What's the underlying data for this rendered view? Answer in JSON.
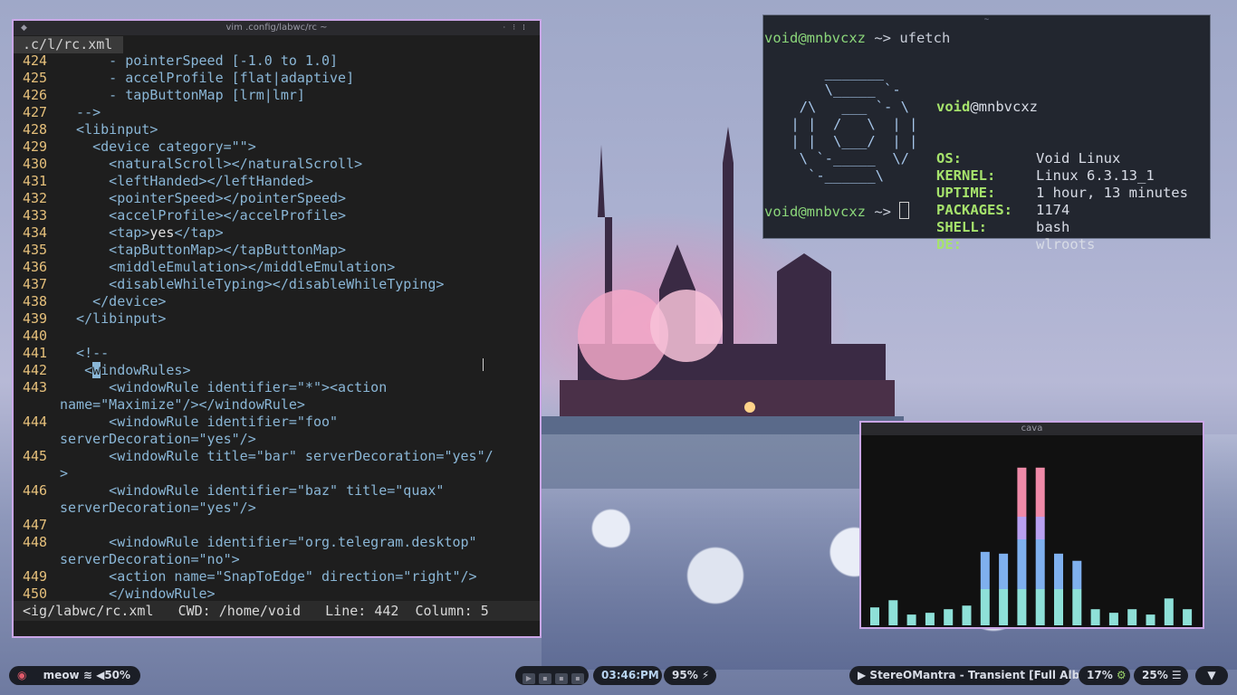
{
  "vim": {
    "title": "vim .config/labwc/rc ~",
    "tab": ".c/l/rc.xml",
    "lines": [
      {
        "n": "424",
        "t": "      - pointerSpeed [-1.0 to 1.0]"
      },
      {
        "n": "425",
        "t": "      - accelProfile [flat|adaptive]"
      },
      {
        "n": "426",
        "t": "      - tapButtonMap [lrm|lmr]"
      },
      {
        "n": "427",
        "t": "  -->"
      },
      {
        "n": "428",
        "t": "  <libinput>"
      },
      {
        "n": "429",
        "t": "    <device category=\"\">"
      },
      {
        "n": "430",
        "t": "      <naturalScroll></naturalScroll>"
      },
      {
        "n": "431",
        "t": "      <leftHanded></leftHanded>"
      },
      {
        "n": "432",
        "t": "      <pointerSpeed></pointerSpeed>"
      },
      {
        "n": "433",
        "t": "      <accelProfile></accelProfile>"
      },
      {
        "n": "434",
        "t": "      <tap>yes</tap>"
      },
      {
        "n": "435",
        "t": "      <tapButtonMap></tapButtonMap>"
      },
      {
        "n": "436",
        "t": "      <middleEmulation></middleEmulation>"
      },
      {
        "n": "437",
        "t": "      <disableWhileTyping></disableWhileTyping>"
      },
      {
        "n": "438",
        "t": "    </device>"
      },
      {
        "n": "439",
        "t": "  </libinput>"
      },
      {
        "n": "440",
        "t": ""
      },
      {
        "n": "441",
        "t": "  <!--"
      },
      {
        "n": "442",
        "t": "   <windowRules>"
      },
      {
        "n": "443",
        "t": "      <windowRule identifier=\"*\"><action"
      },
      {
        "n": "",
        "t": "name=\"Maximize\"/></windowRule>"
      },
      {
        "n": "444",
        "t": "      <windowRule identifier=\"foo\""
      },
      {
        "n": "",
        "t": "serverDecoration=\"yes\"/>"
      },
      {
        "n": "445",
        "t": "      <windowRule title=\"bar\" serverDecoration=\"yes\"/"
      },
      {
        "n": "",
        "t": ">"
      },
      {
        "n": "446",
        "t": "      <windowRule identifier=\"baz\" title=\"quax\""
      },
      {
        "n": "",
        "t": "serverDecoration=\"yes\"/>"
      },
      {
        "n": "447",
        "t": ""
      },
      {
        "n": "448",
        "t": "      <windowRule identifier=\"org.telegram.desktop\""
      },
      {
        "n": "",
        "t": "serverDecoration=\"no\">"
      },
      {
        "n": "449",
        "t": "      <action name=\"SnapToEdge\" direction=\"right\"/>"
      },
      {
        "n": "450",
        "t": "      </windowRule>"
      }
    ],
    "status": "<ig/labwc/rc.xml   CWD: /home/void   Line: 442  Column: 5"
  },
  "terminal": {
    "title": "~",
    "prompt_user": "void",
    "prompt_host": "@mnbvcxz",
    "prompt_arrow": " ~> ",
    "command": "ufetch",
    "logo": [
      "     _______",
      "     \\_____ `-",
      "  /\\   ___ `- \\",
      " | |  /   \\  | |",
      " | |  \\___/  | |",
      "  \\ `-_____  \\/",
      "   `-______\\"
    ],
    "info_title_user": "void",
    "info_title_host": "@mnbvcxz",
    "info": [
      {
        "k": "OS:",
        "v": "Void Linux"
      },
      {
        "k": "KERNEL:",
        "v": "Linux 6.3.13_1"
      },
      {
        "k": "UPTIME:",
        "v": "1 hour, 13 minutes"
      },
      {
        "k": "PACKAGES:",
        "v": "1174"
      },
      {
        "k": "SHELL:",
        "v": "bash"
      },
      {
        "k": "DE:",
        "v": "wlroots"
      }
    ]
  },
  "cava": {
    "title": "cava",
    "levels": [
      0.1,
      0.14,
      0.06,
      0.07,
      0.09,
      0.11,
      0.41,
      0.4,
      0.88,
      0.88,
      0.4,
      0.36,
      0.09,
      0.07,
      0.09,
      0.06,
      0.15,
      0.09
    ],
    "colors": {
      "base": "#8ee0d8",
      "mid": "#7fb0ee",
      "upper": "#b8a0f0",
      "top": "#ef8aa8"
    }
  },
  "bar": {
    "left_name": "meow",
    "volume": "50%",
    "time": "03:46:PM",
    "battery": "95%",
    "media": "StereOMantra - Transient [Full Album]",
    "cpu": "17%",
    "mem": "25%"
  }
}
